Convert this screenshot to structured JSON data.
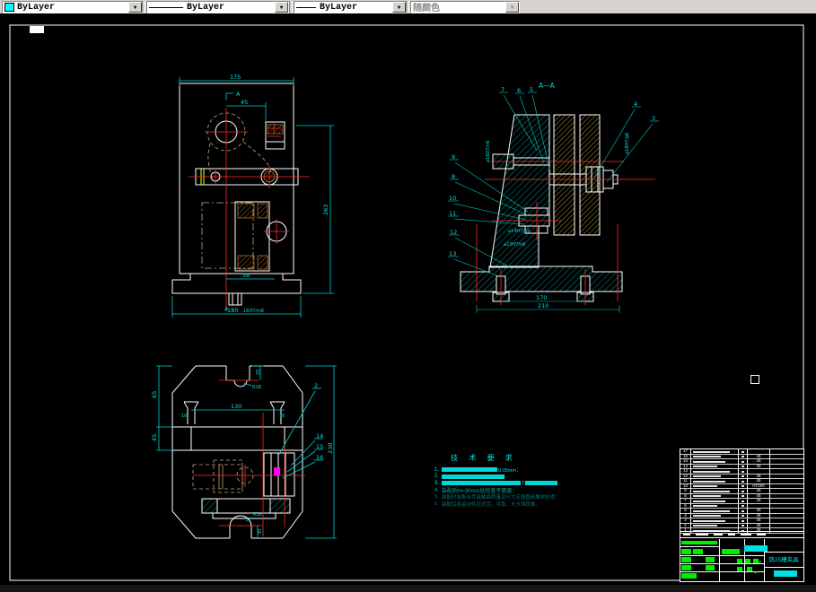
{
  "toolbar": {
    "color_combo": {
      "value": "ByLayer",
      "swatch": "#00ffff"
    },
    "linetype_combo": {
      "value": "ByLayer"
    },
    "lineweight_combo": {
      "value": "ByLayer"
    },
    "plotstyle_combo": {
      "value": "随颜色"
    }
  },
  "front_view": {
    "section_label": "A",
    "dims": {
      "d175": "175",
      "d45": "45",
      "d263": "263",
      "d58": "58",
      "d4": "4",
      "fit16": "16H7/m6",
      "d180": "180"
    }
  },
  "section_view": {
    "title": "A—A",
    "dims": {
      "d170": "170",
      "d210": "210",
      "fit_left": "⌀16D7/n6",
      "fit14": "⌀14H7/n6",
      "fit22": "⌀22H7/n6",
      "fit_right": "⌀18H7/g6"
    },
    "callouts": {
      "c3": "3",
      "c4": "4",
      "c5": "5",
      "c6": "6",
      "c7": "7",
      "c8": "8",
      "c9": "9",
      "c10": "10",
      "c11": "11",
      "c12": "12",
      "c13": "13"
    }
  },
  "plan_view": {
    "dims": {
      "d25": "25",
      "r18_top": "R18",
      "d130": "130",
      "d10l": "10",
      "d10r": "10",
      "d65": "65",
      "d45": "45",
      "d230": "230",
      "r18_bot": "R18",
      "d30": "30"
    },
    "callouts": {
      "c2": "2",
      "c14": "14",
      "c15": "15",
      "c16": "16"
    }
  },
  "tech_req": {
    "title": "技 术 要 求",
    "items": [
      {
        "no": "1.",
        "tail": "0.05mm；"
      },
      {
        "no": "2.",
        "tail": ""
      },
      {
        "no": "3.",
        "tail": "T"
      },
      {
        "no": "4.",
        "text": "装配后H=30mm处检查平面度；"
      },
      {
        "no": "5.",
        "text": "装配时各配合件接触面质量及尺寸应按图纸要求检查；"
      },
      {
        "no": "6.",
        "text": "装配后各运动件应灵活、可靠，无卡滞现象。"
      }
    ]
  },
  "title_block": {
    "product_name": "铣25槽夹具",
    "bom": [
      {
        "seq": "17",
        "mat": ""
      },
      {
        "seq": "16",
        "mat": "45"
      },
      {
        "seq": "15",
        "mat": "45"
      },
      {
        "seq": "14",
        "mat": "45"
      },
      {
        "seq": "13",
        "mat": ""
      },
      {
        "seq": "12",
        "mat": "45"
      },
      {
        "seq": "11",
        "mat": "45"
      },
      {
        "seq": "10",
        "mat": "HT200"
      },
      {
        "seq": "9",
        "mat": "45"
      },
      {
        "seq": "8",
        "mat": "45"
      },
      {
        "seq": "7",
        "mat": "45"
      },
      {
        "seq": "6",
        "mat": ""
      },
      {
        "seq": "5",
        "mat": "45"
      },
      {
        "seq": "4",
        "mat": "45"
      },
      {
        "seq": "3",
        "mat": "45"
      },
      {
        "seq": "2",
        "mat": "45"
      },
      {
        "seq": "1",
        "mat": "45"
      }
    ]
  }
}
